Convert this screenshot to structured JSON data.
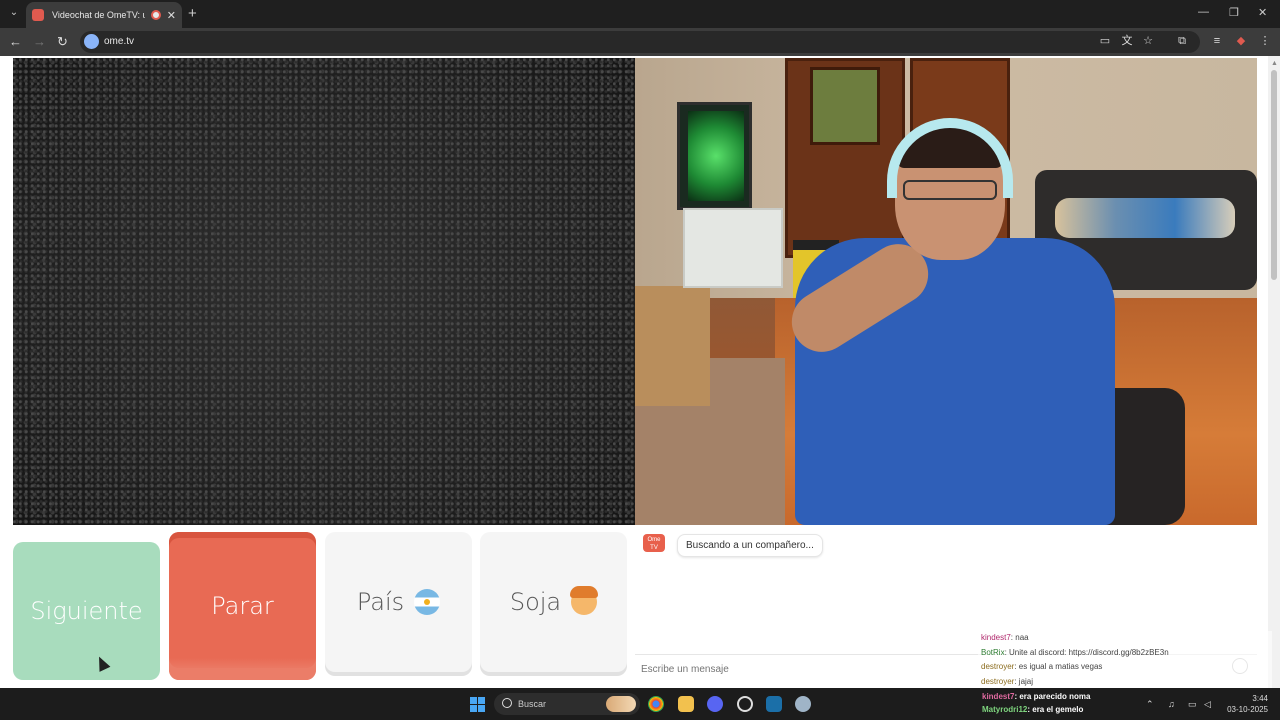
{
  "browser": {
    "tab_title": "Videochat de OmeTV: una",
    "tab_close": "✕",
    "new_tab": "+",
    "url": "ome.tv",
    "window_controls": [
      "—",
      "❐",
      "✕"
    ]
  },
  "controls": {
    "next_label": "Siguiente",
    "stop_label": "Parar",
    "country_label": "País",
    "gender_label": "Soja"
  },
  "chat": {
    "logo_text": "Ome TV",
    "status_message": "Buscando a un compañero...",
    "input_placeholder": "Escribe un mensaje"
  },
  "stream_overlay": {
    "lines": [
      {
        "user": "kindest7",
        "text": ": naa"
      },
      {
        "user": "BotRix",
        "text": ": Unite al discord: https://discord.gg/8b2zBE3n"
      },
      {
        "user": "destroyer",
        "text": ": es igual a matias vegas"
      },
      {
        "user": "destroyer",
        "text": ": jajaj"
      }
    ],
    "bottom_lines": [
      {
        "user": "kindest7",
        "text": ": era parecido noma"
      },
      {
        "user": "Matyrodri12",
        "text": ": era el gemelo"
      }
    ]
  },
  "taskbar": {
    "search_label": "Buscar",
    "time": "3:44",
    "date": "03-10-2025"
  },
  "colors": {
    "next": "#a8dcbd",
    "stop": "#e86a54",
    "accent": "#8ab4f8"
  }
}
